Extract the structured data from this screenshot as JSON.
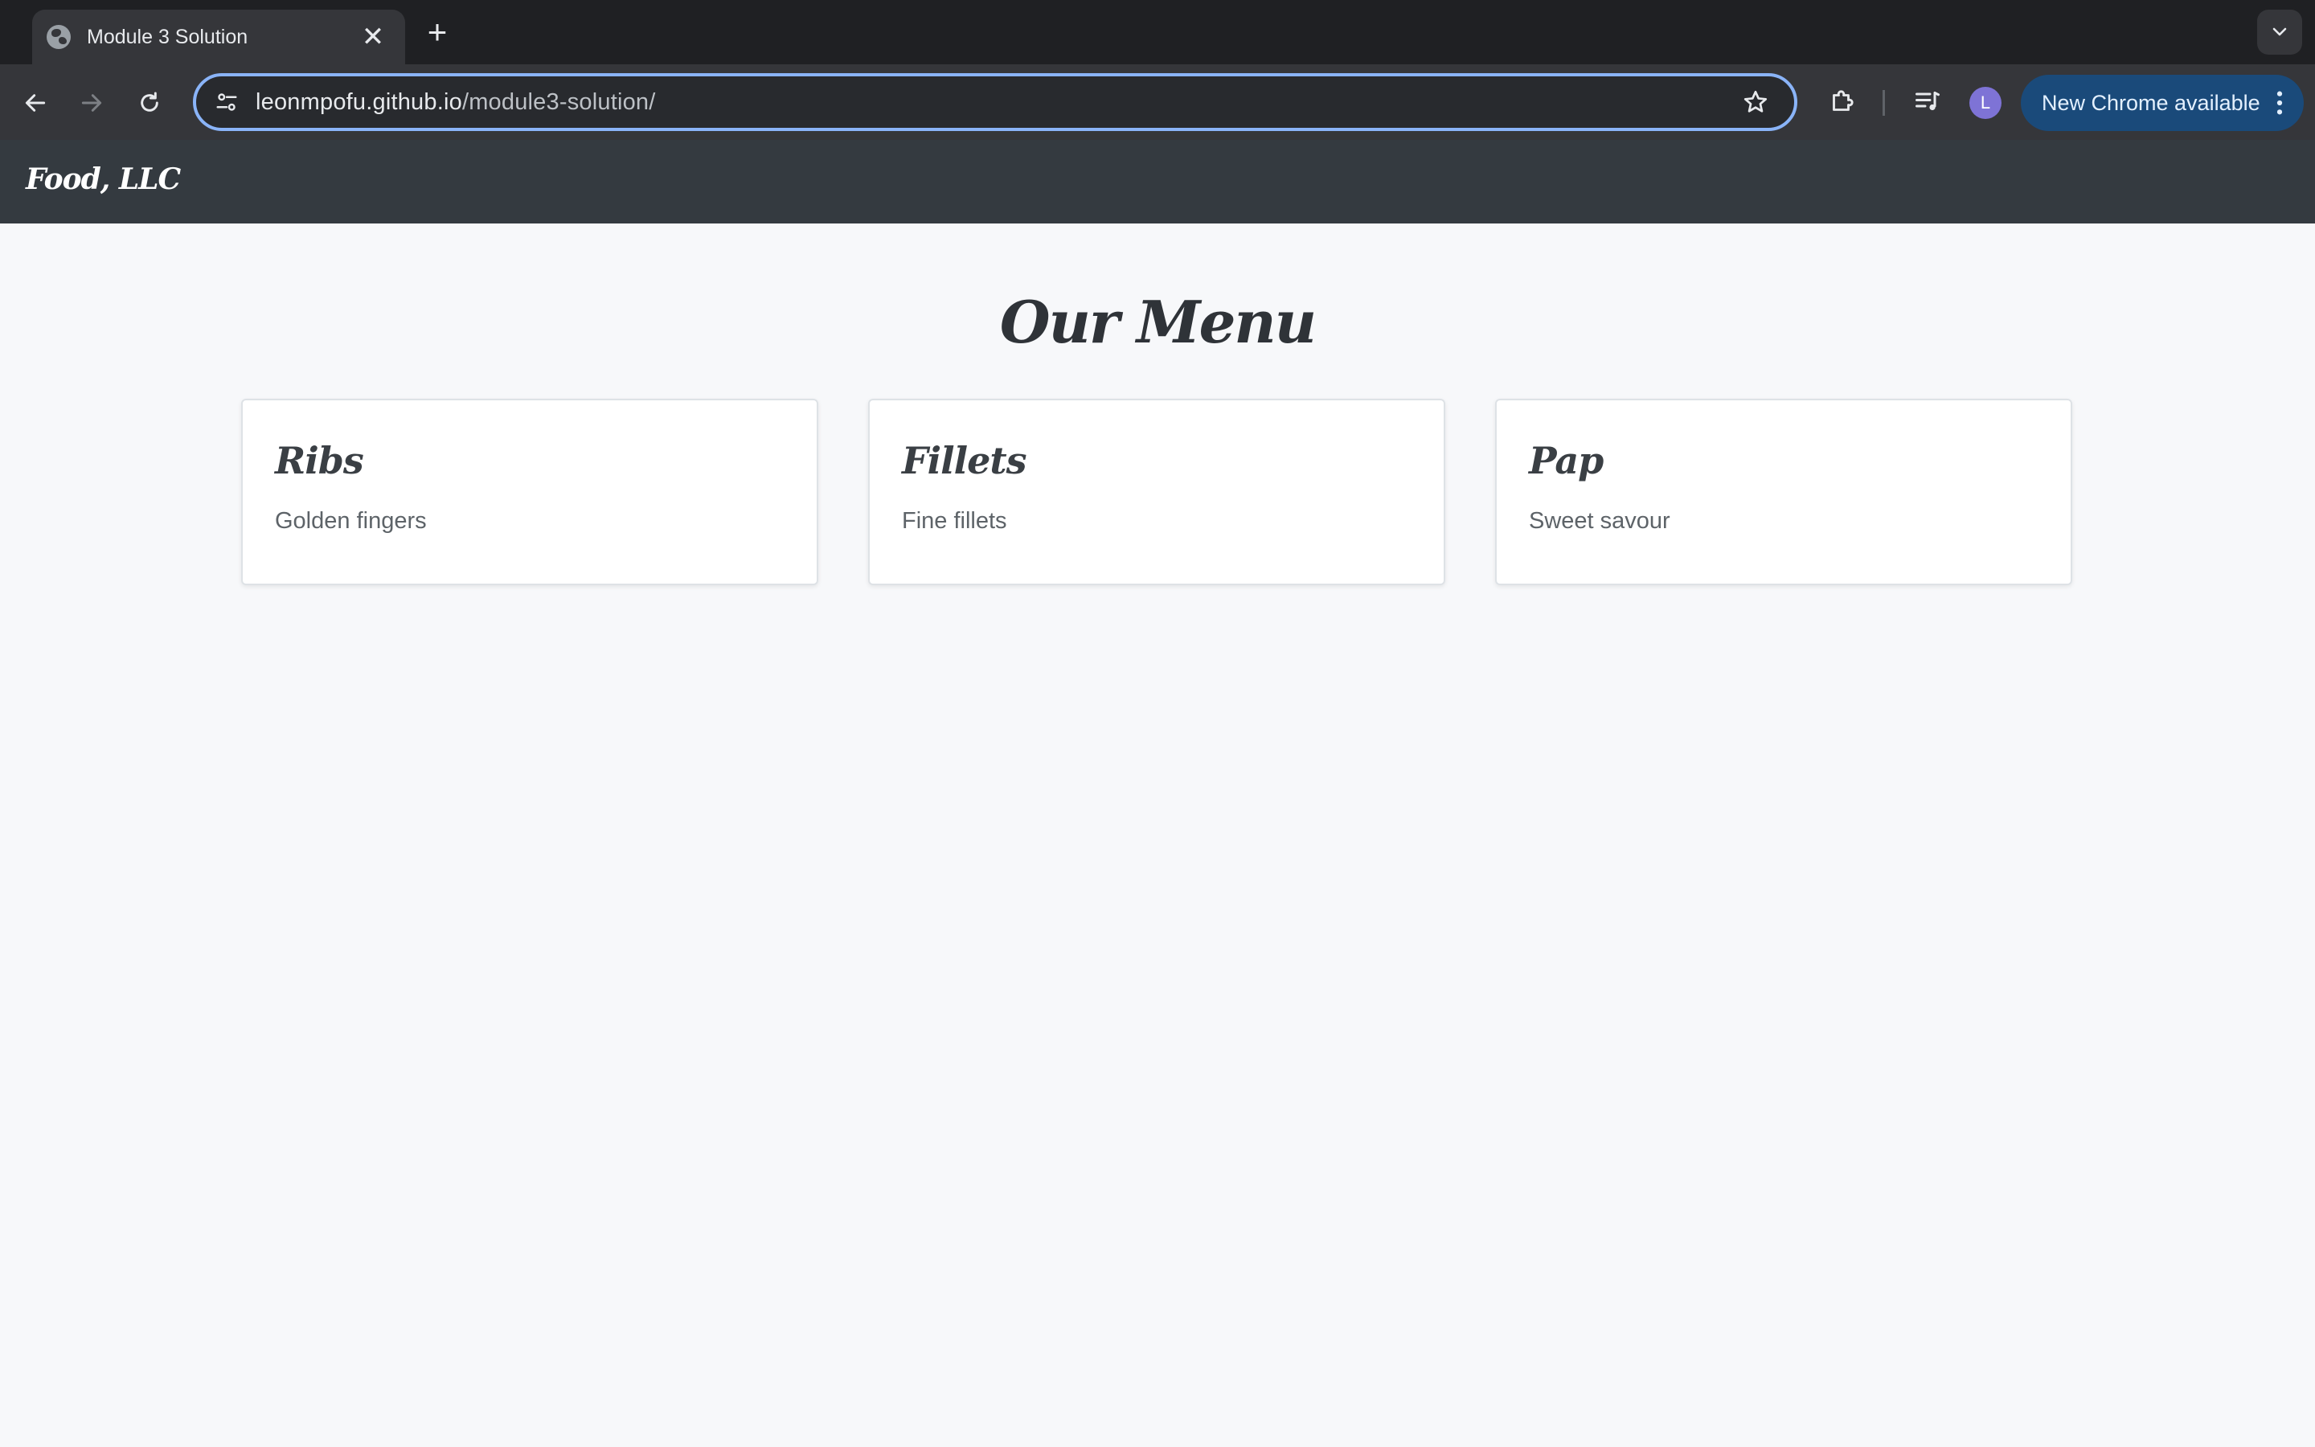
{
  "browser": {
    "tab": {
      "title": "Module 3 Solution",
      "close_glyph": "✕"
    },
    "new_tab_glyph": "+",
    "address": {
      "host": "leonmpofu.github.io",
      "path": "/module3-solution/"
    },
    "profile_initial": "L",
    "update_label": "New Chrome available",
    "accent": "#8ab4f8"
  },
  "site": {
    "brand": "Food, LLC",
    "heading": "Our Menu",
    "items": [
      {
        "title": "Ribs",
        "description": "Golden fingers"
      },
      {
        "title": "Fillets",
        "description": "Fine fillets"
      },
      {
        "title": "Pap",
        "description": "Sweet savour"
      }
    ]
  }
}
